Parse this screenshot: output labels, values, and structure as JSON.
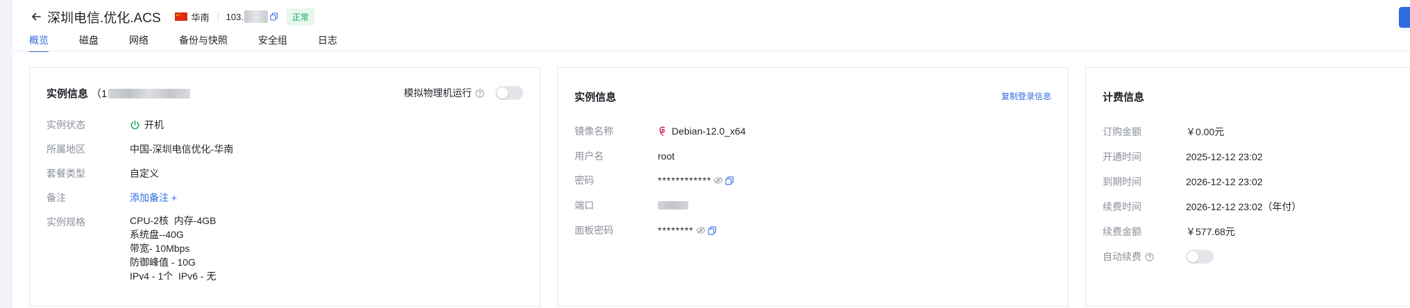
{
  "header": {
    "title": "深圳电信.优化.ACS",
    "region": "华南",
    "ip_prefix": "103.",
    "status": "正常"
  },
  "tabs": [
    "概览",
    "磁盘",
    "网络",
    "备份与快照",
    "安全组",
    "日志"
  ],
  "instance_card": {
    "title": "实例信息",
    "id_prefix": "（1",
    "simulate_label": "模拟物理机运行",
    "simulate_on": false,
    "fields": {
      "state_label": "实例状态",
      "state_value": "开机",
      "region_label": "所属地区",
      "region_value": "中国-深圳电信优化-华南",
      "plan_label": "套餐类型",
      "plan_value": "自定义",
      "note_label": "备注",
      "note_link": "添加备注 +",
      "spec_label": "实例规格",
      "spec_lines": [
        "CPU-2核  内存-4GB",
        "系统盘--40G",
        "带宽- 10Mbps",
        "防御峰值 - 10G",
        "IPv4 - 1个  IPv6 - 无"
      ]
    }
  },
  "login_card": {
    "title": "实例信息",
    "copy_link": "复制登录信息",
    "image_label": "镜像名称",
    "image_value": "Debian-12.0_x64",
    "user_label": "用户名",
    "user_value": "root",
    "password_label": "密码",
    "password_value": "************",
    "port_label": "端口",
    "panel_password_label": "面板密码",
    "panel_password_value": "********"
  },
  "billing_card": {
    "title": "计费信息",
    "order_amount_label": "订购金额",
    "order_amount_value": "￥0.00元",
    "open_time_label": "开通时间",
    "open_time_value": "2025-12-12 23:02",
    "expire_time_label": "到期时间",
    "expire_time_value": "2026-12-12 23:02",
    "renew_time_label": "续费时间",
    "renew_time_value": "2026-12-12 23:02（年付）",
    "renew_amount_label": "续费金额",
    "renew_amount_value": "￥577.68元",
    "auto_renew_label": "自动续费",
    "auto_renew_on": false
  },
  "colors": {
    "accent": "#2f6be0",
    "status_green": "#12a65a",
    "label_gray": "#8a8f99"
  }
}
